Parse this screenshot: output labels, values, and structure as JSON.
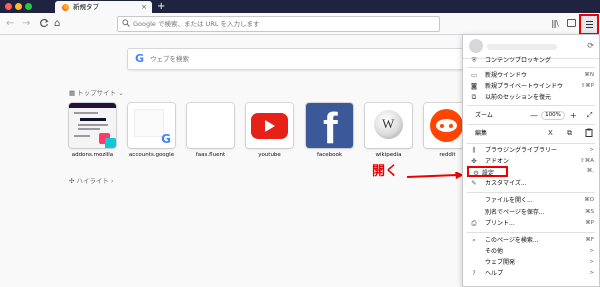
{
  "tab": {
    "title": "新規タブ",
    "close": "×",
    "new_tab": "+"
  },
  "toolbar": {
    "back": "←",
    "forward": "→",
    "reload": "C",
    "home": "⌂",
    "url_placeholder": "Google で検索、または URL を入力します",
    "library": "|||\\",
    "search_icon": "search-icon",
    "menu_icon": "hamburger-menu-icon"
  },
  "newtab": {
    "search_logo": "G",
    "search_placeholder": "ウェブを検索",
    "topsites_title": "トップサイト",
    "highlights_title": "ハイライト",
    "chevron": "⌄",
    "top_sites": [
      {
        "label": "addons.mozilla",
        "thumbnail": "addons-page-thumbnail"
      },
      {
        "label": "accounts.google",
        "thumbnail": "google-logo"
      },
      {
        "label": "faas.fluent",
        "thumbnail": "blank"
      },
      {
        "label": "youtube",
        "thumbnail": "youtube-logo"
      },
      {
        "label": "facebook",
        "thumbnail": "facebook-logo",
        "logo_text": "f"
      },
      {
        "label": "wikipedia",
        "thumbnail": "wikipedia-globe",
        "logo_text": "W"
      },
      {
        "label": "reddit",
        "thumbnail": "reddit-logo"
      }
    ],
    "thumb_g": "G"
  },
  "annotation": {
    "text": "開く",
    "color": "#ee0000"
  },
  "app_menu": {
    "sync_icon": "⟳",
    "items": [
      {
        "label": "コンテンツブロッキング",
        "icon": "shield-icon",
        "shortcut": ""
      },
      {
        "label": "新規ウインドウ",
        "icon": "window-icon",
        "shortcut": "⌘N"
      },
      {
        "label": "新規プライベートウインドウ",
        "icon": "private-mask-icon",
        "shortcut": "⇧⌘P"
      },
      {
        "label": "以前のセッションを復元",
        "icon": "restore-icon",
        "shortcut": ""
      },
      {
        "label": "ズーム",
        "icon": "",
        "shortcut": ""
      },
      {
        "label": "編集",
        "icon": "",
        "shortcut": ""
      },
      {
        "label": "ブラウジングライブラリー",
        "icon": "library-icon",
        "shortcut": ">"
      },
      {
        "label": "アドオン",
        "icon": "puzzle-icon",
        "shortcut": "⇧⌘A"
      },
      {
        "label": "設定",
        "icon": "gear-icon",
        "shortcut": "⌘,"
      },
      {
        "label": "カスタマイズ...",
        "icon": "paintbrush-icon",
        "shortcut": ""
      },
      {
        "label": "ファイルを開く...",
        "icon": "",
        "shortcut": "⌘O"
      },
      {
        "label": "別名でページを保存...",
        "icon": "",
        "shortcut": "⌘S"
      },
      {
        "label": "プリント...",
        "icon": "printer-icon",
        "shortcut": "⌘P"
      },
      {
        "label": "このページを検索...",
        "icon": "search-icon",
        "shortcut": "⌘F"
      },
      {
        "label": "その他",
        "icon": "",
        "shortcut": ">"
      },
      {
        "label": "ウェブ開発",
        "icon": "",
        "shortcut": ">"
      },
      {
        "label": "ヘルプ",
        "icon": "help-icon",
        "shortcut": ">"
      }
    ],
    "zoom": {
      "minus": "—",
      "value": "100%",
      "plus": "+",
      "fullscreen": "⤢"
    },
    "edit": {
      "cut": "X",
      "copy": "⧉",
      "paste": "📋"
    }
  },
  "colors": {
    "tabbar": "#202340",
    "highlight": "#ee0000",
    "youtube": "#e62117",
    "facebook": "#3b5998",
    "reddit": "#ff4500"
  }
}
